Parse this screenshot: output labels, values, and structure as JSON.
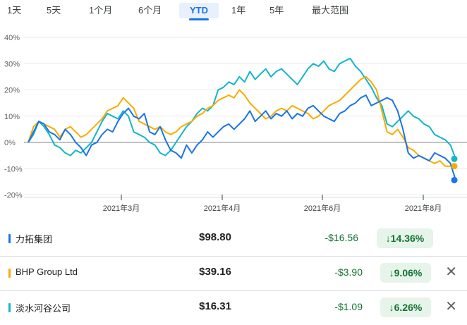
{
  "range_tabs": [
    "1天",
    "5天",
    "1个月",
    "6个月",
    "YTD",
    "1年",
    "5年",
    "最大范围"
  ],
  "active_tab": "YTD",
  "colors": {
    "liuzhou": "#1a73e8",
    "bhp": "#f9ab00",
    "danshui": "#12b5cb",
    "positive_bg": "#e6f4ea",
    "positive_text": "#137333"
  },
  "chart_data": {
    "type": "line",
    "y_ticks": [
      "40%",
      "30%",
      "20%",
      "10%",
      "0%",
      "-10%",
      "-20%"
    ],
    "ylim": [
      -20,
      40
    ],
    "x_ticks": [
      "2021年3月",
      "2021年4月",
      "2021年6月",
      "2021年8月"
    ],
    "series": [
      {
        "name": "力拓集团",
        "values": [
          0,
          4,
          8,
          7,
          4,
          3,
          1,
          5,
          3,
          0,
          -2,
          -5,
          -1,
          0,
          3,
          5,
          4,
          8,
          11,
          13,
          10,
          9,
          11,
          4,
          3,
          6,
          1,
          -3,
          -4,
          -6,
          -1,
          -4,
          -1,
          1,
          4,
          2,
          4,
          6,
          7,
          5,
          7,
          9,
          12,
          8,
          10,
          12,
          9,
          11,
          10,
          12,
          9,
          11,
          10,
          13,
          14,
          12,
          10,
          9,
          8,
          11,
          12,
          14,
          15,
          17,
          18,
          14,
          15,
          16,
          17,
          16,
          12,
          5,
          -4,
          -6,
          -5,
          -6,
          -7,
          -4,
          -5,
          -6,
          -8,
          -14.36
        ]
      },
      {
        "name": "BHP Group Ltd",
        "values": [
          0,
          6,
          8,
          7,
          6,
          5,
          2,
          5,
          6,
          4,
          2,
          3,
          5,
          7,
          9,
          12,
          13,
          14,
          17,
          15,
          13,
          8,
          7,
          6,
          5,
          6,
          4,
          3,
          4,
          6,
          7,
          8,
          10,
          11,
          13,
          14,
          16,
          17,
          18,
          17,
          20,
          18,
          15,
          13,
          11,
          9,
          10,
          12,
          13,
          12,
          14,
          13,
          12,
          11,
          9,
          10,
          12,
          14,
          15,
          16,
          18,
          20,
          22,
          24,
          25,
          23,
          20,
          12,
          4,
          3,
          5,
          2,
          -2,
          -3,
          -5,
          -6,
          -7,
          -8,
          -7,
          -9.06,
          -9.06,
          -9.06
        ]
      },
      {
        "name": "淡水河谷公司",
        "values": [
          0,
          3,
          8,
          6,
          3,
          -1,
          -2,
          -4,
          -5,
          -3,
          -4,
          -2,
          0,
          4,
          8,
          11,
          10,
          9,
          12,
          10,
          4,
          3,
          2,
          0,
          -1,
          -4,
          -5,
          -3,
          0,
          3,
          6,
          8,
          11,
          13,
          12,
          14,
          20,
          21,
          23,
          22,
          25,
          23,
          27,
          24,
          26,
          28,
          25,
          27,
          28,
          26,
          24,
          22,
          25,
          28,
          30,
          29,
          31,
          28,
          27,
          30,
          31,
          32,
          29,
          27,
          24,
          21,
          17,
          14,
          7,
          6,
          8,
          10,
          12,
          10,
          9,
          7,
          6,
          3,
          2,
          1,
          -1,
          -6.26
        ]
      }
    ]
  },
  "stocks": [
    {
      "name": "力拓集团",
      "price": "$98.80",
      "change": "-$16.56",
      "percent": "↓14.36%",
      "close": ""
    },
    {
      "name": "BHP Group Ltd",
      "price": "$39.16",
      "change": "-$3.90",
      "percent": "↓9.06%",
      "close": "✕"
    },
    {
      "name": "淡水河谷公司",
      "price": "$16.31",
      "change": "-$1.09",
      "percent": "↓6.26%",
      "close": "✕"
    }
  ]
}
